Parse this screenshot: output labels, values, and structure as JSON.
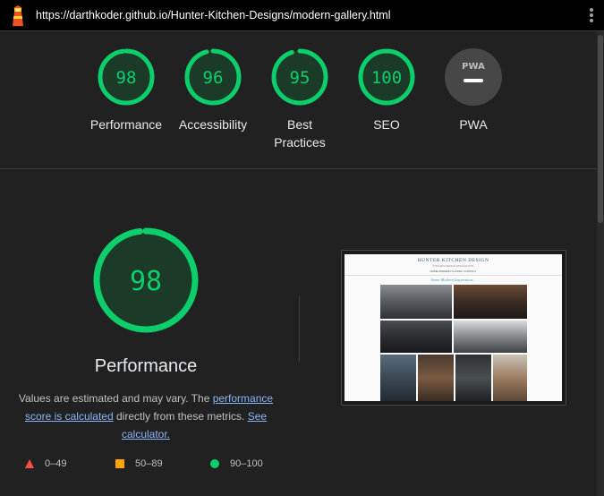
{
  "topbar": {
    "url": "https://darthkoder.github.io/Hunter-Kitchen-Designs/modern-gallery.html"
  },
  "gauges": [
    {
      "label": "Performance",
      "score": "98",
      "value": 98
    },
    {
      "label": "Accessibility",
      "score": "96",
      "value": 96
    },
    {
      "label": "Best Practices",
      "score": "95",
      "value": 95
    },
    {
      "label": "SEO",
      "score": "100",
      "value": 100
    },
    {
      "label": "PWA",
      "score": "",
      "value": null
    }
  ],
  "pwa_badge": "PWA",
  "performance": {
    "score": "98",
    "value": 98,
    "title": "Performance",
    "desc_prefix": "Values are estimated and may vary. The ",
    "link1": "performance score is calculated",
    "desc_middle": " directly from these metrics. ",
    "link2": "See calculator."
  },
  "legend": [
    {
      "range": "0–49",
      "shape": "triangle",
      "color": "#ff4e42"
    },
    {
      "range": "50–89",
      "shape": "square",
      "color": "#ffa400"
    },
    {
      "range": "90–100",
      "shape": "circle",
      "color": "#0cce6b"
    }
  ],
  "screenshot": {
    "heading": "HUNTER KITCHEN DESIGN",
    "subheading": "KITCHEN DESIGN SPECIALISTS",
    "nav": "HOME   MODERN   CLASSIC   CONTACT",
    "tagline": "Some Modern Inspiration..."
  },
  "colors": {
    "pass": "#0cce6b",
    "pass_fill": "#1b3a28",
    "pwa_gray": "#474747"
  }
}
